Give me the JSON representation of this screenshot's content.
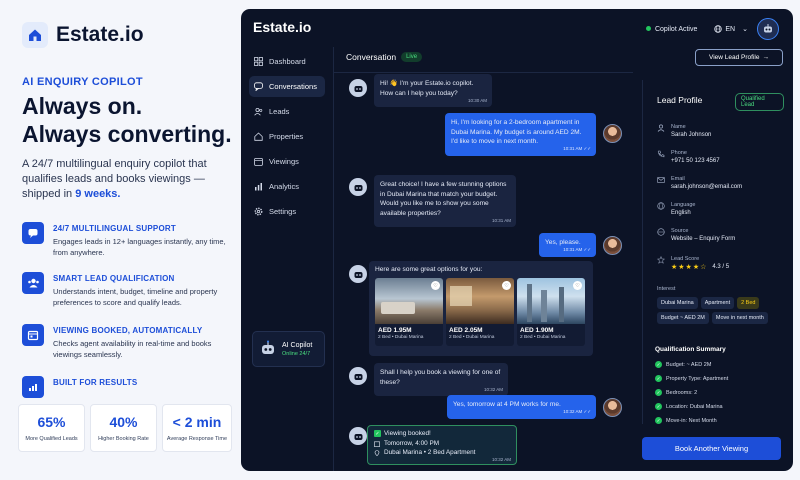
{
  "marketing": {
    "brand": "Estate.io",
    "eyebrow": "AI ENQUIRY COPILOT",
    "headline_1": "Always on.",
    "headline_2": "Always converting.",
    "desc_pre": "A 24/7 multilingual enquiry copilot that qualifies leads and books viewings — shipped in ",
    "desc_bold": "9 weeks.",
    "features": [
      {
        "title": "24/7 MULTILINGUAL SUPPORT",
        "desc": "Engages leads in 12+ languages instantly, any time, from anywhere."
      },
      {
        "title": "SMART LEAD QUALIFICATION",
        "desc": "Understands intent, budget, timeline and property preferences to score and qualify leads."
      },
      {
        "title": "VIEWING BOOKED, AUTOMATICALLY",
        "desc": "Checks agent availability in real-time and books viewings seamlessly."
      },
      {
        "title": "BUILT FOR RESULTS",
        "desc": ""
      }
    ],
    "stats": [
      {
        "value": "65%",
        "label": "More Qualified Leads"
      },
      {
        "value": "40%",
        "label": "Higher Booking Rate"
      },
      {
        "value": "< 2 min",
        "label": "Average Response Time"
      }
    ]
  },
  "app": {
    "title": "Estate.io",
    "status": "Copilot Active",
    "language": "EN",
    "nav": [
      "Dashboard",
      "Conversations",
      "Leads",
      "Properties",
      "Viewings",
      "Analytics",
      "Settings"
    ],
    "copilot_card": {
      "title": "AI Copilot",
      "status": "Online 24/7"
    }
  },
  "conversation": {
    "title": "Conversation",
    "live": "Live",
    "view_lead": "View Lead Profile",
    "messages": [
      {
        "text": "Hi! 👋 I'm your Estate.io copilot. How can I help you today?",
        "time": "10:30 AM"
      },
      {
        "text": "Hi, I'm looking for a 2-bedroom apartment in Dubai Marina. My budget is around AED 2M. I'd like to move in next month.",
        "time": "10:31 AM ✓✓"
      },
      {
        "text": "Great choice! I have a few stunning options in Dubai Marina that match your budget. Would you like me to show you some available properties?",
        "time": "10:31 AM"
      },
      {
        "text": "Yes, please.",
        "time": "10:31 AM ✓✓"
      },
      {
        "text": "Shall I help you book a viewing for one of these?",
        "time": "10:32 AM"
      },
      {
        "text": "Yes, tomorrow at 4 PM works for me.",
        "time": "10:32 AM ✓✓"
      }
    ],
    "options_title": "Here are some great options for you:",
    "properties": [
      {
        "price": "AED 1.95M",
        "detail": "2 Bed • Dubai Marina"
      },
      {
        "price": "AED 2.05M",
        "detail": "2 Bed • Dubai Marina"
      },
      {
        "price": "AED 1.90M",
        "detail": "2 Bed • Dubai Marina"
      }
    ],
    "booked": {
      "title": "Viewing booked!",
      "when": "Tomorrow, 4:00 PM",
      "where": "Dubai Marina • 2 Bed Apartment",
      "time": "10:32 AM"
    }
  },
  "lead": {
    "title": "Lead Profile",
    "badge": "Qualified Lead",
    "fields": [
      {
        "label": "Name",
        "value": "Sarah Johnson"
      },
      {
        "label": "Phone",
        "value": "+971 50 123 4567"
      },
      {
        "label": "Email",
        "value": "sarah.johnson@email.com"
      },
      {
        "label": "Language",
        "value": "English"
      },
      {
        "label": "Source",
        "value": "Website – Enquiry Form"
      }
    ],
    "score_label": "Lead Score",
    "score_stars": "★★★★☆",
    "score": "4.3 / 5",
    "interest_label": "Interest",
    "interests": [
      "Dubai Marina",
      "Apartment",
      "2 Bed",
      "Budget ~ AED 2M",
      "Move in next month"
    ],
    "summary_title": "Qualification Summary",
    "summary": [
      "Budget: ~ AED 2M",
      "Property Type: Apartment",
      "Bedrooms: 2",
      "Location: Dubai Marina",
      "Move-in: Next Month"
    ],
    "book_button": "Book Another Viewing"
  }
}
